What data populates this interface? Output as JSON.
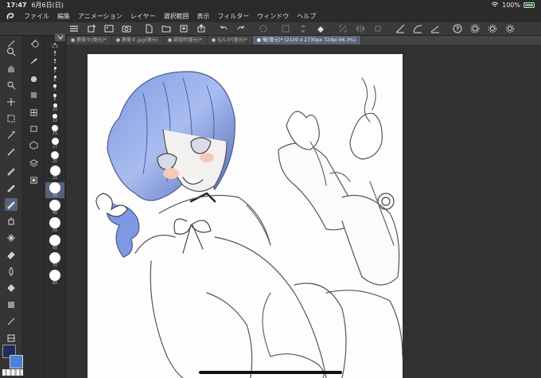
{
  "status": {
    "time": "17:47",
    "date": "6月6日(日)",
    "battery": "100%"
  },
  "menu": [
    "ファイル",
    "編集",
    "アニメーション",
    "レイヤー",
    "選択範囲",
    "表示",
    "フィルター",
    "ウィンドウ",
    "ヘルプ"
  ],
  "tabs": [
    {
      "label": "鹿美々(復元)*"
    },
    {
      "label": "鹿美々.jpg(復元)"
    },
    {
      "label": "師宣ff(復元)*"
    },
    {
      "label": "なんか(復元)*"
    },
    {
      "label": "俺(復元)* (2100 x 2730px 72dpi 66.3%)"
    }
  ],
  "brush_sizes": [
    "2.5",
    "3",
    "4",
    "5",
    "6",
    "7",
    "8",
    "10",
    "12",
    "15",
    "17",
    "20",
    "25",
    "30",
    "40",
    "50",
    "60",
    "70",
    "80"
  ],
  "selected_brush_size": "30",
  "colors": {
    "main": "#1f2f5c",
    "sub": "#4d7fdc",
    "accent": "#55637d"
  }
}
